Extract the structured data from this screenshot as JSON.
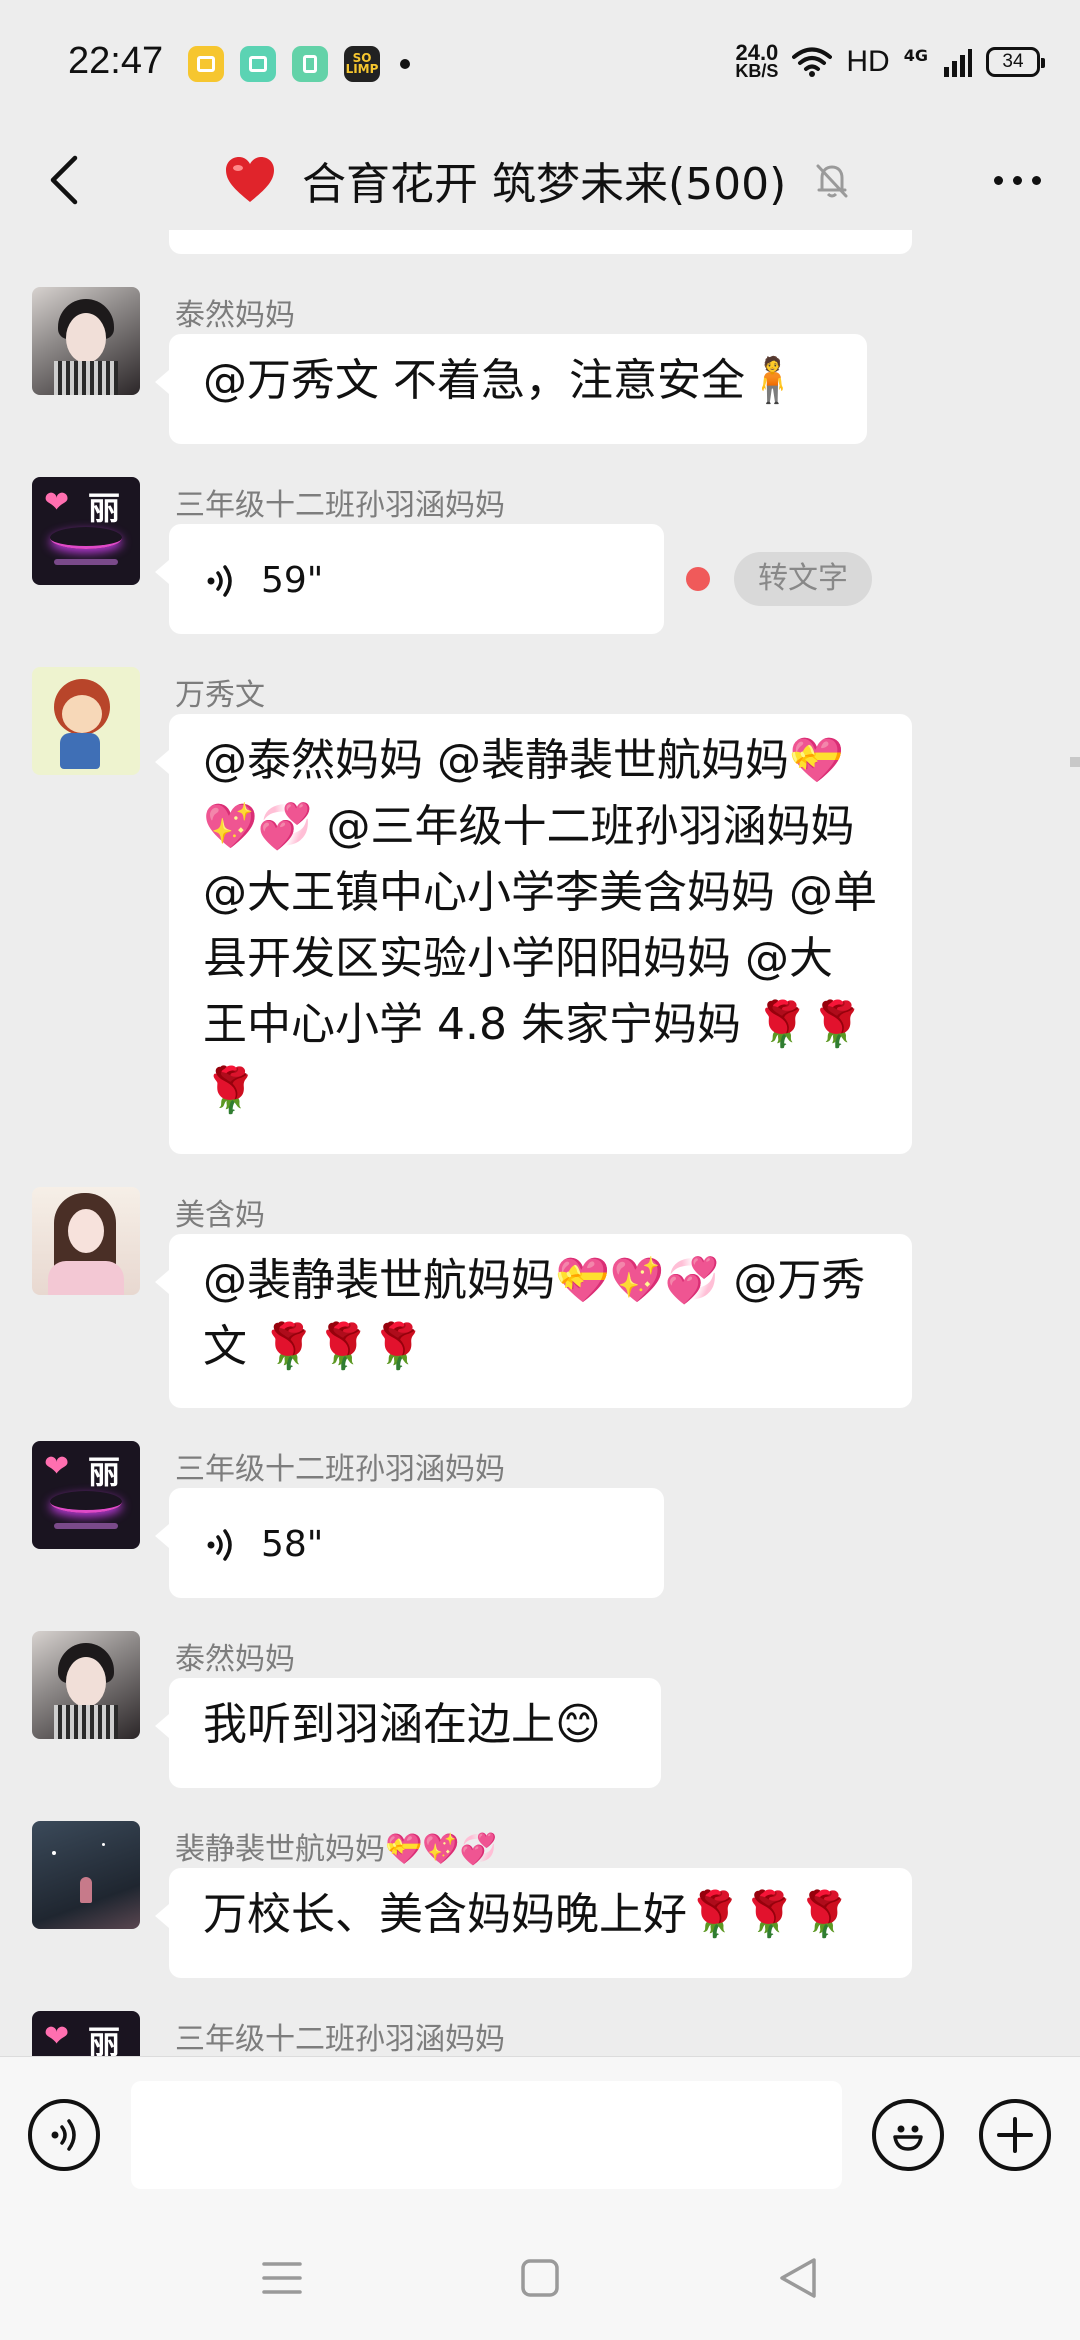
{
  "status_bar": {
    "time": "22:47",
    "notif_icon_4": "SO LIMP",
    "net_speed_value": "24.0",
    "net_speed_unit": "KB/S",
    "hd": "HD",
    "net_type": "4G",
    "battery": "34"
  },
  "header": {
    "title_icon": "red-heart-emoji",
    "title": "合育花开 筑梦未来(500)",
    "back_icon": "chevron-left-icon",
    "mute_icon": "bell-muted-icon",
    "more_icon": "more-dots-icon"
  },
  "messages": [
    {
      "sender": "泰然妈妈",
      "text": "@万秀文  不着急，注意安全",
      "emoji": "🧍"
    },
    {
      "sender": "三年级十二班孙羽涵妈妈",
      "voice_duration": "59\"",
      "to_text_label": "转文字"
    },
    {
      "sender": "万秀文",
      "lines": [
        "@泰然妈妈  @裴静裴世航妈妈💝",
        "💖💞 @三年级十二班孙羽涵妈妈",
        "@大王镇中心小学李美含妈妈  @单",
        "县开发区实验小学阳阳妈妈  @大",
        "王中心小学 4.8 朱家宁妈妈  🌹🌹",
        "🌹"
      ]
    },
    {
      "sender": "美含妈",
      "lines": [
        "@裴静裴世航妈妈💝💖💞 @万秀",
        "文  🌹🌹🌹"
      ]
    },
    {
      "sender": "三年级十二班孙羽涵妈妈",
      "voice_duration": "58\""
    },
    {
      "sender": "泰然妈妈",
      "text": "我听到羽涵在边上",
      "emoji": "😊"
    },
    {
      "sender": "裴静裴世航妈妈💝💖💞",
      "text": "万校长、美含妈妈晚上好🌹🌹🌹"
    },
    {
      "sender": "三年级十二班孙羽涵妈妈"
    }
  ],
  "input_bar": {
    "voice_icon": "voice-input-icon",
    "emoji_icon": "emoji-icon",
    "add_icon": "plus-icon",
    "placeholder": ""
  },
  "nav_bar": {
    "menu_icon": "menu-icon",
    "home_icon": "home-square-icon",
    "back_icon": "back-triangle-icon"
  },
  "colors": {
    "background": "#ededed",
    "bubble": "#ffffff",
    "unread_dot": "#f05a5a",
    "sender_text": "#7d7d7d"
  }
}
